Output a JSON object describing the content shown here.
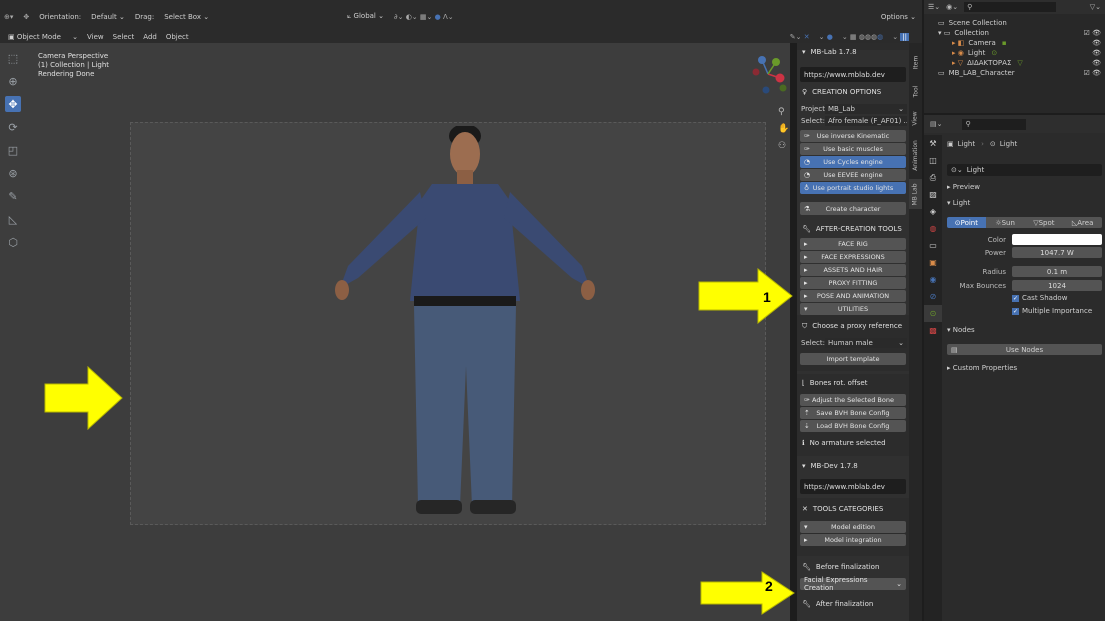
{
  "header": {
    "orientation_label": "Orientation:",
    "orientation_value": "Default",
    "drag_label": "Drag:",
    "drag_value": "Select Box",
    "transform_value": "Global",
    "options_label": "Options"
  },
  "menubar": {
    "mode": "Object Mode",
    "items": [
      "View",
      "Select",
      "Add",
      "Object"
    ]
  },
  "viewport": {
    "info": [
      "Camera Perspective",
      "(1) Collection | Light",
      "Rendering Done"
    ]
  },
  "npanel": {
    "mblab_title": "MB-Lab 1.7.8",
    "mblab_url": "https://www.mblab.dev",
    "creation_options": "CREATION OPTIONS",
    "project_label": "Project:",
    "project_value": "MB_Lab",
    "select_label": "Select:",
    "select_value": "Afro female (F_AF01) ...",
    "options": [
      {
        "label": "Use inverse Kinematic",
        "active": false
      },
      {
        "label": "Use basic muscles",
        "active": false
      },
      {
        "label": "Use Cycles engine",
        "active": true
      },
      {
        "label": "Use EEVEE engine",
        "active": false
      },
      {
        "label": "Use portrait studio lights",
        "active": true
      }
    ],
    "create_character": "Create character",
    "after_creation": "AFTER-CREATION TOOLS",
    "after_items": [
      "FACE RIG",
      "FACE EXPRESSIONS",
      "ASSETS AND HAIR",
      "PROXY FITTING",
      "POSE AND ANIMATION",
      "UTILITIES"
    ],
    "proxy_ref": "Choose a proxy reference",
    "proxy_select_label": "Select:",
    "proxy_select_value": "Human male",
    "import_template": "Import template",
    "bones_rot": "Bones rot. offset",
    "bone_buttons": [
      "Adjust the Selected Bone",
      "Save BVH Bone Config",
      "Load BVH Bone Config"
    ],
    "no_armature": "No armature selected",
    "mbdev_title": "MB-Dev 1.7.8",
    "mbdev_url": "https://www.mblab.dev",
    "tools_categories": "TOOLS CATEGORIES",
    "tool_cats": [
      "Model edition",
      "Model integration"
    ],
    "before_final": "Before finalization",
    "facial_expr": "Facial Expressions Creation",
    "after_final": "After finalization"
  },
  "sidetabs": [
    "Item",
    "Tool",
    "View",
    "Animation",
    "MB Lab"
  ],
  "outliner": {
    "search_placeholder": "",
    "rows": [
      "Scene Collection",
      "Collection",
      "Camera",
      "Light",
      "ΔΙΔΑΚΤΟΡΑΣ",
      "MB_LAB_Character"
    ]
  },
  "properties": {
    "breadcrumb_obj": "Light",
    "breadcrumb_data": "Light",
    "datablock": "Light",
    "preview": "Preview",
    "light_section": "Light",
    "light_types": [
      "Point",
      "Sun",
      "Spot",
      "Area"
    ],
    "color_label": "Color",
    "color_value": "#ffffff",
    "power_label": "Power",
    "power_value": "1047.7 W",
    "radius_label": "Radius",
    "radius_value": "0.1 m",
    "bounces_label": "Max Bounces",
    "bounces_value": "1024",
    "cast_shadow": "Cast Shadow",
    "multiple_importance": "Multiple Importance",
    "nodes": "Nodes",
    "use_nodes": "Use Nodes",
    "custom_props": "Custom Properties"
  },
  "annotations": {
    "label1": "1",
    "label2": "2",
    "arrow_color": "#ffff00"
  },
  "colors": {
    "accent": "#4772b3"
  }
}
